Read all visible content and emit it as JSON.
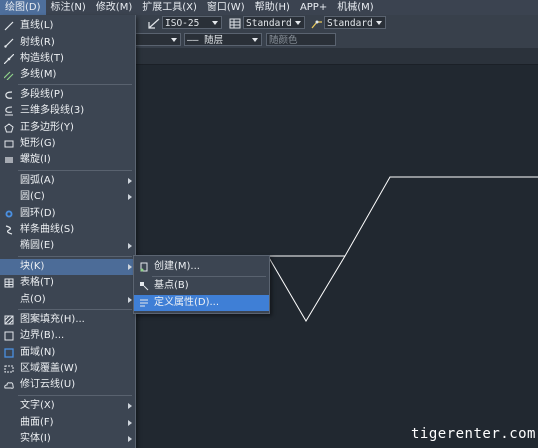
{
  "menubar": {
    "items": [
      "绘图(D)",
      "标注(N)",
      "修改(M)",
      "扩展工具(X)",
      "窗口(W)",
      "帮助(H)",
      "APP+",
      "机械(M)"
    ]
  },
  "toolbar": {
    "dimstyle": "ISO-25",
    "tablestyle": "Standard",
    "multileaderstyle": "Standard",
    "linetype": "—— 随层",
    "lineweight": "随颜色"
  },
  "draw_menu": {
    "items": [
      {
        "label": "直线(L)",
        "icon": "line-icon",
        "submenu": false
      },
      {
        "label": "射线(R)",
        "icon": "ray-icon",
        "submenu": false
      },
      {
        "label": "构造线(T)",
        "icon": "xline-icon",
        "submenu": false
      },
      {
        "label": "多线(M)",
        "icon": "multiline-icon",
        "submenu": false
      },
      {
        "label": "多段线(P)",
        "icon": "polyline-icon",
        "submenu": false
      },
      {
        "label": "三维多段线(3)",
        "icon": "3d-polyline-icon",
        "submenu": false
      },
      {
        "label": "正多边形(Y)",
        "icon": "polygon-icon",
        "submenu": false
      },
      {
        "label": "矩形(G)",
        "icon": "rectangle-icon",
        "submenu": false
      },
      {
        "label": "螺旋(I)",
        "icon": "helix-icon",
        "submenu": false
      },
      {
        "label": "圆弧(A)",
        "icon": "",
        "submenu": true
      },
      {
        "label": "圆(C)",
        "icon": "",
        "submenu": true
      },
      {
        "label": "圆环(D)",
        "icon": "donut-icon",
        "submenu": false
      },
      {
        "label": "样条曲线(S)",
        "icon": "spline-icon",
        "submenu": false
      },
      {
        "label": "椭圆(E)",
        "icon": "",
        "submenu": true
      },
      {
        "label": "块(K)",
        "icon": "",
        "submenu": true
      },
      {
        "label": "表格(T)",
        "icon": "table-icon",
        "submenu": false
      },
      {
        "label": "点(O)",
        "icon": "",
        "submenu": true
      },
      {
        "label": "图案填充(H)...",
        "icon": "hatch-icon",
        "submenu": false
      },
      {
        "label": "边界(B)...",
        "icon": "boundary-icon",
        "submenu": false
      },
      {
        "label": "面域(N)",
        "icon": "region-icon",
        "submenu": false
      },
      {
        "label": "区域覆盖(W)",
        "icon": "wipeout-icon",
        "submenu": false
      },
      {
        "label": "修订云线(U)",
        "icon": "revcloud-icon",
        "submenu": false
      },
      {
        "label": "文字(X)",
        "icon": "",
        "submenu": true
      },
      {
        "label": "曲面(F)",
        "icon": "",
        "submenu": true
      },
      {
        "label": "实体(I)",
        "icon": "",
        "submenu": true
      }
    ]
  },
  "block_submenu": {
    "items": [
      {
        "label": "创建(M)...",
        "icon": "block-create-icon"
      },
      {
        "label": "基点(B)",
        "icon": "base-point-icon"
      },
      {
        "label": "定义属性(D)...",
        "icon": "define-attribute-icon"
      }
    ]
  },
  "watermark": "tigerenter.com",
  "colors": {
    "canvas": "#212830",
    "menu_bg": "#3c4552",
    "highlight": "#3f7fd6",
    "drawing_line": "#ffffff"
  }
}
